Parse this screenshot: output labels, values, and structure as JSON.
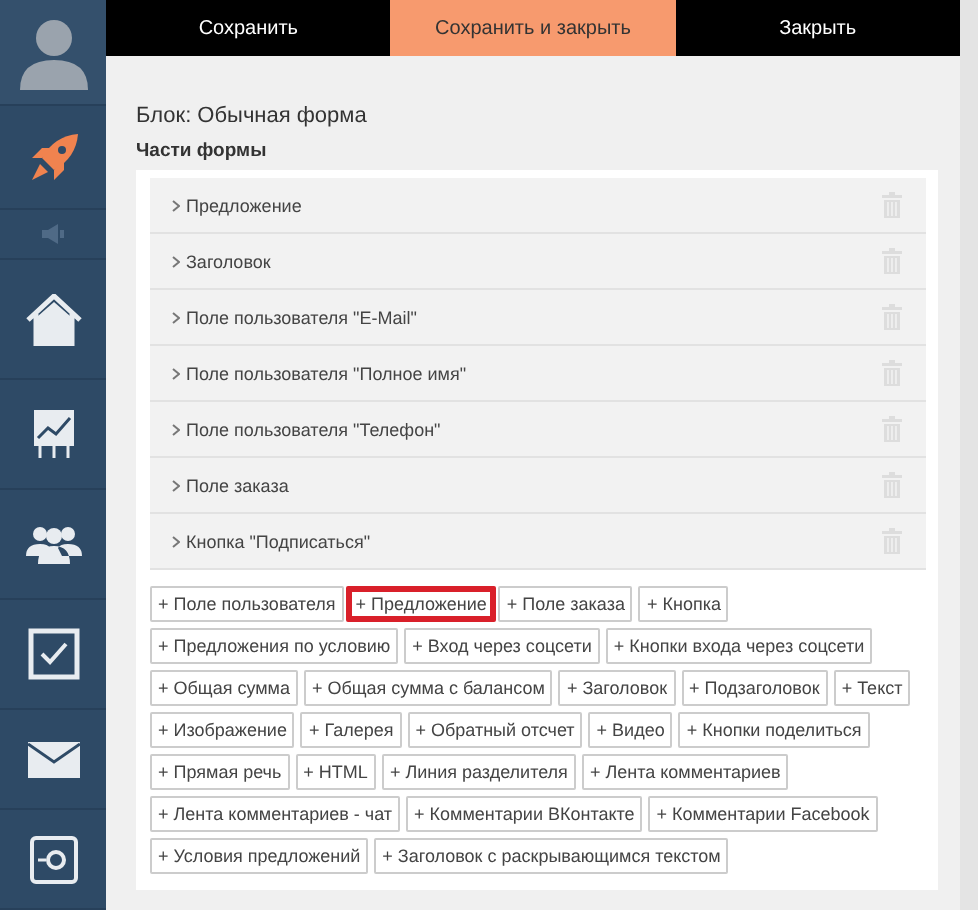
{
  "sidebar": {
    "items": [
      {
        "kind": "avatar",
        "selected": false
      },
      {
        "kind": "rocket",
        "selected": true
      },
      {
        "kind": "speaker",
        "selected": false
      },
      {
        "kind": "home",
        "selected": false
      },
      {
        "kind": "chart",
        "selected": false
      },
      {
        "kind": "people",
        "selected": false
      },
      {
        "kind": "check",
        "selected": false
      },
      {
        "kind": "mail",
        "selected": false
      },
      {
        "kind": "safe",
        "selected": false
      }
    ]
  },
  "toolbar": [
    {
      "label": "Сохранить",
      "selected": false
    },
    {
      "label": "Сохранить и закрыть",
      "selected": true
    },
    {
      "label": "Закрыть",
      "selected": false
    }
  ],
  "block_title": "Блок: Обычная форма",
  "section_title": "Части формы",
  "parts": [
    {
      "label": "Предложение"
    },
    {
      "label": "Заголовок"
    },
    {
      "label": "Поле пользователя \"E-Mail\""
    },
    {
      "label": "Поле пользователя \"Полное имя\""
    },
    {
      "label": "Поле пользователя \"Телефон\""
    },
    {
      "label": "Поле заказа"
    },
    {
      "label": "Кнопка \"Подписаться\""
    }
  ],
  "add_buttons": [
    {
      "label": "+ Поле пользователя",
      "highlighted": false
    },
    {
      "label": "+ Предложение",
      "highlighted": true
    },
    {
      "label": "+ Поле заказа",
      "highlighted": false
    },
    {
      "label": "+ Кнопка",
      "highlighted": false
    },
    {
      "label": "+ Предложения по условию",
      "highlighted": false
    },
    {
      "label": "+ Вход через соцсети",
      "highlighted": false
    },
    {
      "label": "+ Кнопки входа через соцсети",
      "highlighted": false
    },
    {
      "label": "+ Общая сумма",
      "highlighted": false
    },
    {
      "label": "+ Общая сумма с балансом",
      "highlighted": false
    },
    {
      "label": "+ Заголовок",
      "highlighted": false
    },
    {
      "label": "+ Подзаголовок",
      "highlighted": false
    },
    {
      "label": "+ Текст",
      "highlighted": false
    },
    {
      "label": "+ Изображение",
      "highlighted": false
    },
    {
      "label": "+ Галерея",
      "highlighted": false
    },
    {
      "label": "+ Обратный отсчет",
      "highlighted": false
    },
    {
      "label": "+ Видео",
      "highlighted": false
    },
    {
      "label": "+ Кнопки поделиться",
      "highlighted": false
    },
    {
      "label": "+ Прямая речь",
      "highlighted": false
    },
    {
      "label": "+ HTML",
      "highlighted": false
    },
    {
      "label": "+ Линия разделителя",
      "highlighted": false
    },
    {
      "label": "+ Лента комментариев",
      "highlighted": false
    },
    {
      "label": "+ Лента комментариев - чат",
      "highlighted": false
    },
    {
      "label": "+ Комментарии ВКонтакте",
      "highlighted": false
    },
    {
      "label": "+ Комментарии Facebook",
      "highlighted": false
    },
    {
      "label": "+ Условия предложений",
      "highlighted": false
    },
    {
      "label": "+ Заголовок с раскрывающимся текстом",
      "highlighted": false
    }
  ]
}
